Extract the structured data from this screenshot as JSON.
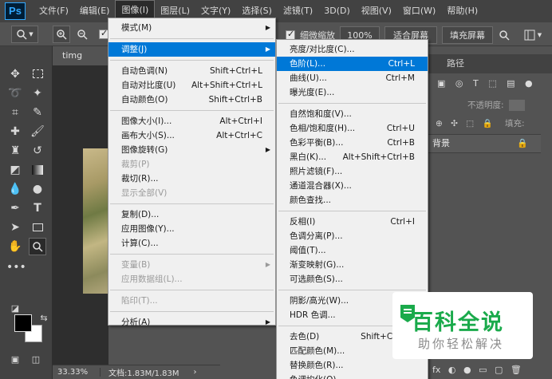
{
  "app": {
    "logo": "Ps"
  },
  "menubar": {
    "items": [
      "文件(F)",
      "编辑(E)",
      "图像(I)",
      "图层(L)",
      "文字(Y)",
      "选择(S)",
      "滤镜(T)",
      "3D(D)",
      "视图(V)",
      "窗口(W)",
      "帮助(H)"
    ],
    "active_index": 2
  },
  "options_bar": {
    "fine_zoom_label": "细微缩放",
    "zoom_pct": "100%",
    "fit_screen": "适合屏幕",
    "fill_screen": "填充屏幕"
  },
  "document": {
    "tab_title": "timg (2).jpg",
    "zoom_status": "33.33%",
    "doc_size": "文档:1.83M/1.83M"
  },
  "right_panel": {
    "tab_path": "路径",
    "opacity_label": "不透明度:",
    "fill_label": "填充:",
    "layer_name": "背景"
  },
  "image_menu": {
    "items": [
      {
        "label": "模式(M)",
        "submenu": true
      },
      {
        "sep": true
      },
      {
        "label": "调整(J)",
        "submenu": true,
        "highlight": true
      },
      {
        "sep": true
      },
      {
        "label": "自动色调(N)",
        "shortcut": "Shift+Ctrl+L"
      },
      {
        "label": "自动对比度(U)",
        "shortcut": "Alt+Shift+Ctrl+L"
      },
      {
        "label": "自动颜色(O)",
        "shortcut": "Shift+Ctrl+B"
      },
      {
        "sep": true
      },
      {
        "label": "图像大小(I)...",
        "shortcut": "Alt+Ctrl+I"
      },
      {
        "label": "画布大小(S)...",
        "shortcut": "Alt+Ctrl+C"
      },
      {
        "label": "图像旋转(G)",
        "submenu": true
      },
      {
        "label": "裁剪(P)",
        "disabled": true
      },
      {
        "label": "裁切(R)..."
      },
      {
        "label": "显示全部(V)",
        "disabled": true
      },
      {
        "sep": true
      },
      {
        "label": "复制(D)..."
      },
      {
        "label": "应用图像(Y)..."
      },
      {
        "label": "计算(C)..."
      },
      {
        "sep": true
      },
      {
        "label": "变量(B)",
        "submenu": true,
        "disabled": true
      },
      {
        "label": "应用数据组(L)...",
        "disabled": true
      },
      {
        "sep": true
      },
      {
        "label": "陷印(T)...",
        "disabled": true
      },
      {
        "sep": true
      },
      {
        "label": "分析(A)",
        "submenu": true
      }
    ]
  },
  "adjust_submenu": {
    "items": [
      {
        "label": "亮度/对比度(C)..."
      },
      {
        "label": "色阶(L)...",
        "shortcut": "Ctrl+L",
        "highlight": true
      },
      {
        "label": "曲线(U)...",
        "shortcut": "Ctrl+M"
      },
      {
        "label": "曝光度(E)..."
      },
      {
        "sep": true
      },
      {
        "label": "自然饱和度(V)..."
      },
      {
        "label": "色相/饱和度(H)...",
        "shortcut": "Ctrl+U"
      },
      {
        "label": "色彩平衡(B)...",
        "shortcut": "Ctrl+B"
      },
      {
        "label": "黑白(K)...",
        "shortcut": "Alt+Shift+Ctrl+B"
      },
      {
        "label": "照片滤镜(F)..."
      },
      {
        "label": "通道混合器(X)..."
      },
      {
        "label": "颜色查找..."
      },
      {
        "sep": true
      },
      {
        "label": "反相(I)",
        "shortcut": "Ctrl+I"
      },
      {
        "label": "色调分离(P)..."
      },
      {
        "label": "阈值(T)..."
      },
      {
        "label": "渐变映射(G)..."
      },
      {
        "label": "可选颜色(S)..."
      },
      {
        "sep": true
      },
      {
        "label": "阴影/高光(W)..."
      },
      {
        "label": "HDR 色调..."
      },
      {
        "sep": true
      },
      {
        "label": "去色(D)",
        "shortcut": "Shift+Ctrl+U"
      },
      {
        "label": "匹配颜色(M)..."
      },
      {
        "label": "替换颜色(R)..."
      },
      {
        "label": "色调均化(Q)"
      }
    ]
  },
  "watermark": {
    "main": "百科全说",
    "sub": "助你轻松解决"
  },
  "colors": {
    "highlight": "#0078d7",
    "watermark_green": "#1aaa4b"
  }
}
